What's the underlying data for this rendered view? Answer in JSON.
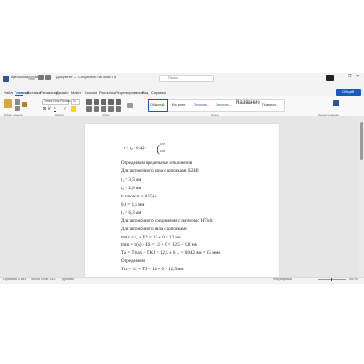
{
  "titlebar": {
    "autosave_label": "Автосохранение",
    "doc_title": "Документ — Сохранено на этом ПК",
    "search_placeholder": "Поиск",
    "window_controls": [
      "—",
      "❐",
      "✕"
    ]
  },
  "menu": {
    "tabs": [
      "Файл",
      "Главная",
      "Вставка",
      "Рисование",
      "Дизайн",
      "Макет",
      "Ссылки",
      "Рассылки",
      "Рецензирование",
      "Вид",
      "Справка"
    ],
    "share_label": "Общий доступ"
  },
  "ribbon": {
    "font_name": "Times New Roman",
    "font_size": "14",
    "format_buttons": [
      "Ж",
      "К",
      "Ч",
      "A"
    ],
    "styles": [
      "Обычный",
      "Без инте...",
      "Заголово...",
      "Заголово...",
      "Название",
      "Подзагол..."
    ],
    "group_labels": [
      "Буфер обмена",
      "Шрифт",
      "Абзац",
      "Стили",
      "Редактирование"
    ]
  },
  "document": {
    "equation": {
      "lhs": "t = t₀ · 0,42 ·",
      "sup": "0,53",
      "sub": "0,82"
    },
    "lines": [
      "Определяем предельные отклонения",
      "Для шпоночного паза с шпонками Б2Н0",
      "t₁ = 3,5 мм",
      "t₂ = 2,8 мм",
      "b шпонки = 8,15(+...",
      "0,6 = 1,5 мм",
      "t₁ = 6,3 мм",
      "Для шпоночного соединения с натягом с Н7/к6:",
      "Для шпоночного вала с шпонками",
      "tmax = t₁ + ES = 12 + 0 = 12 мм",
      "tmin = ti(s) - ES = 12 + 0 = 12,5 − 0,8 мм",
      "Tai = Tmax − TK1 = 12,5 ± 6 ... = 0,042 мм = 15 мкм",
      "Определяем",
      "Tcp = 12 + TS = 12 + 0 = 12,5 мм"
    ]
  },
  "statusbar": {
    "page": "Страница 3 из 5",
    "words": "Число слов: 412",
    "lang": "русский",
    "focus": "Фокусировка",
    "zoom": "100 %"
  },
  "colors": {
    "accent": "#185abd",
    "word_blue": "#2b579a"
  }
}
